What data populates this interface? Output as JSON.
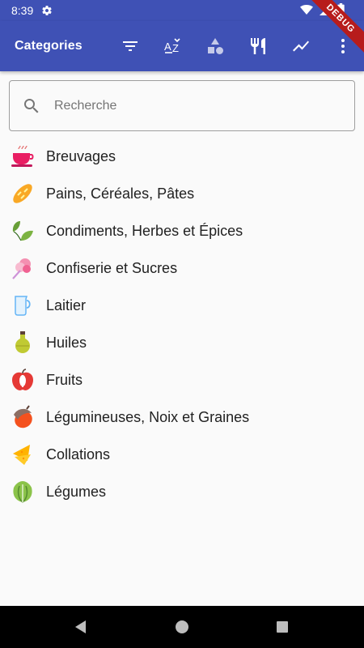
{
  "status_bar": {
    "time": "8:39",
    "icons": [
      "gear-icon",
      "wifi-icon",
      "signal-icon",
      "battery-icon"
    ]
  },
  "debug_banner": "DEBUG",
  "app_bar": {
    "title": "Categories",
    "actions": [
      "filter-icon",
      "sort-az-icon",
      "shapes-icon",
      "restaurant-icon",
      "trending-icon",
      "more-vert-icon"
    ],
    "background": "#3f51b5"
  },
  "search": {
    "placeholder": "Recherche",
    "value": ""
  },
  "categories": [
    {
      "label": "Breuvages",
      "icon": "teacup-icon"
    },
    {
      "label": "Pains, Céréales, Pâtes",
      "icon": "bread-icon"
    },
    {
      "label": "Condiments, Herbes et Épices",
      "icon": "leaves-icon"
    },
    {
      "label": "Confiserie et Sucres",
      "icon": "cotton-candy-icon"
    },
    {
      "label": "Laitier",
      "icon": "milk-jug-icon"
    },
    {
      "label": "Huiles",
      "icon": "oil-bottle-icon"
    },
    {
      "label": "Fruits",
      "icon": "apple-icon"
    },
    {
      "label": "Légumineuses, Noix et Graines",
      "icon": "acorn-icon"
    },
    {
      "label": "Collations",
      "icon": "chips-icon"
    },
    {
      "label": "Légumes",
      "icon": "lettuce-icon"
    }
  ],
  "nav_bar": [
    "back-icon",
    "home-icon",
    "recents-icon"
  ]
}
